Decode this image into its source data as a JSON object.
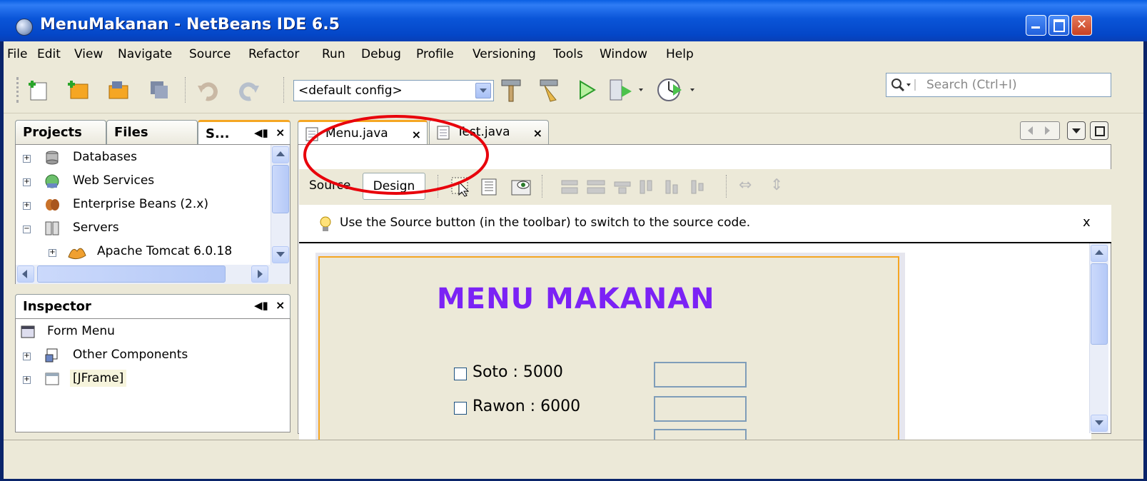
{
  "window": {
    "title": "MenuMakanan - NetBeans IDE 6.5"
  },
  "menubar": [
    "File",
    "Edit",
    "View",
    "Navigate",
    "Source",
    "Refactor",
    "Run",
    "Debug",
    "Profile",
    "Versioning",
    "Tools",
    "Window",
    "Help"
  ],
  "toolbar": {
    "config": "<default config>",
    "search_placeholder": "Search (Ctrl+I)"
  },
  "projects_panel": {
    "tabs": [
      "Projects",
      "Files",
      "S..."
    ],
    "tree": [
      {
        "label": "Databases"
      },
      {
        "label": "Web Services"
      },
      {
        "label": "Enterprise Beans (2.x)"
      },
      {
        "label": "Servers"
      },
      {
        "label": "Apache Tomcat 6.0.18"
      }
    ]
  },
  "inspector_panel": {
    "title": "Inspector",
    "tree": [
      {
        "label": "Form Menu"
      },
      {
        "label": "Other Components"
      },
      {
        "label": "[JFrame]"
      }
    ]
  },
  "editor": {
    "tabs": [
      "Menu.java",
      "Test.java"
    ],
    "source_button": "Source",
    "design_button": "Design",
    "hint": "Use the Source button (in the toolbar) to switch to the source code.",
    "hint_close": "x"
  },
  "form": {
    "heading": "MENU MAKANAN",
    "items": [
      {
        "label": "Soto : 5000"
      },
      {
        "label": "Rawon : 6000"
      }
    ]
  },
  "colors": {
    "accent_tab": "#f5a623",
    "form_heading": "#7b22f5",
    "annotation": "#e8000b"
  }
}
